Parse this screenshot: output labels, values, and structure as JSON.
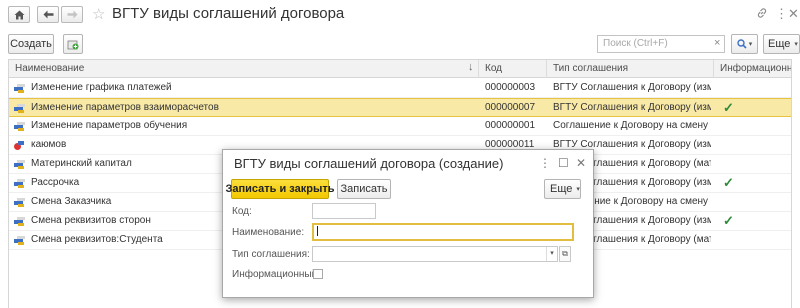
{
  "window": {
    "title": "ВГТУ виды соглашений договора"
  },
  "icons": {
    "home": "home-icon",
    "back": "arrow-left-icon",
    "forward": "arrow-right-icon",
    "favorite": "star-icon",
    "link": "link-icon",
    "more": "more-vertical-icon",
    "close": "close-icon"
  },
  "toolbar": {
    "create_label": "Создать",
    "search_placeholder": "Поиск (Ctrl+F)",
    "more_label": "Еще",
    "help_label": "?"
  },
  "table": {
    "columns": [
      "Наименование",
      "Код",
      "Тип соглашения",
      "Информационный"
    ],
    "rows": [
      {
        "name": "Изменение графика платежей",
        "code": "000000003",
        "type": "ВГТУ Соглашения к Договору (измен...",
        "info": "",
        "selected": false,
        "deleted": false
      },
      {
        "name": "Изменение параметров взаиморасчетов",
        "code": "000000007",
        "type": "ВГТУ Соглашения к Договору (измен...",
        "info": "✓",
        "selected": true,
        "deleted": false
      },
      {
        "name": "Изменение параметров обучения",
        "code": "000000001",
        "type": "Соглашение к Договору на смену рекви...",
        "info": "",
        "selected": false,
        "deleted": false
      },
      {
        "name": "каюмов",
        "code": "000000011",
        "type": "ВГТУ Соглашения к Договору (измен...",
        "info": "",
        "selected": false,
        "deleted": true
      },
      {
        "name": "Материнский капитал",
        "code": "",
        "type": "ВГТУ Соглашения к Договору (матер...",
        "info": "",
        "selected": false,
        "deleted": false
      },
      {
        "name": "Рассрочка",
        "code": "",
        "type": "ВГТУ Соглашения к Договору (измен...",
        "info": "✓",
        "selected": false,
        "deleted": false
      },
      {
        "name": "Смена Заказчика",
        "code": "",
        "type": "Соглашение к Договору на смену Заказ...",
        "info": "",
        "selected": false,
        "deleted": false
      },
      {
        "name": "Смена реквизитов сторон",
        "code": "",
        "type": "ВГТУ Соглашения к Договору (измен...",
        "info": "✓",
        "selected": false,
        "deleted": false
      },
      {
        "name": "Смена реквизитов:Студента",
        "code": "",
        "type": "ВГТУ Соглашения к Договору (матер...",
        "info": "",
        "selected": false,
        "deleted": false
      }
    ]
  },
  "dialog": {
    "title": "ВГТУ виды соглашений договора (создание)",
    "save_close_label": "Записать и закрыть",
    "save_label": "Записать",
    "more_label": "Еще",
    "fields": {
      "code_label": "Код:",
      "code_value": "",
      "name_label": "Наименование:",
      "name_value": "",
      "type_label": "Тип соглашения:",
      "type_value": "",
      "info_label": "Информационный:",
      "info_checked": false
    }
  },
  "colors": {
    "selected_row": "#f8e9a7",
    "primary_button": "#f2c800",
    "checkmark": "#2e8b3a"
  }
}
